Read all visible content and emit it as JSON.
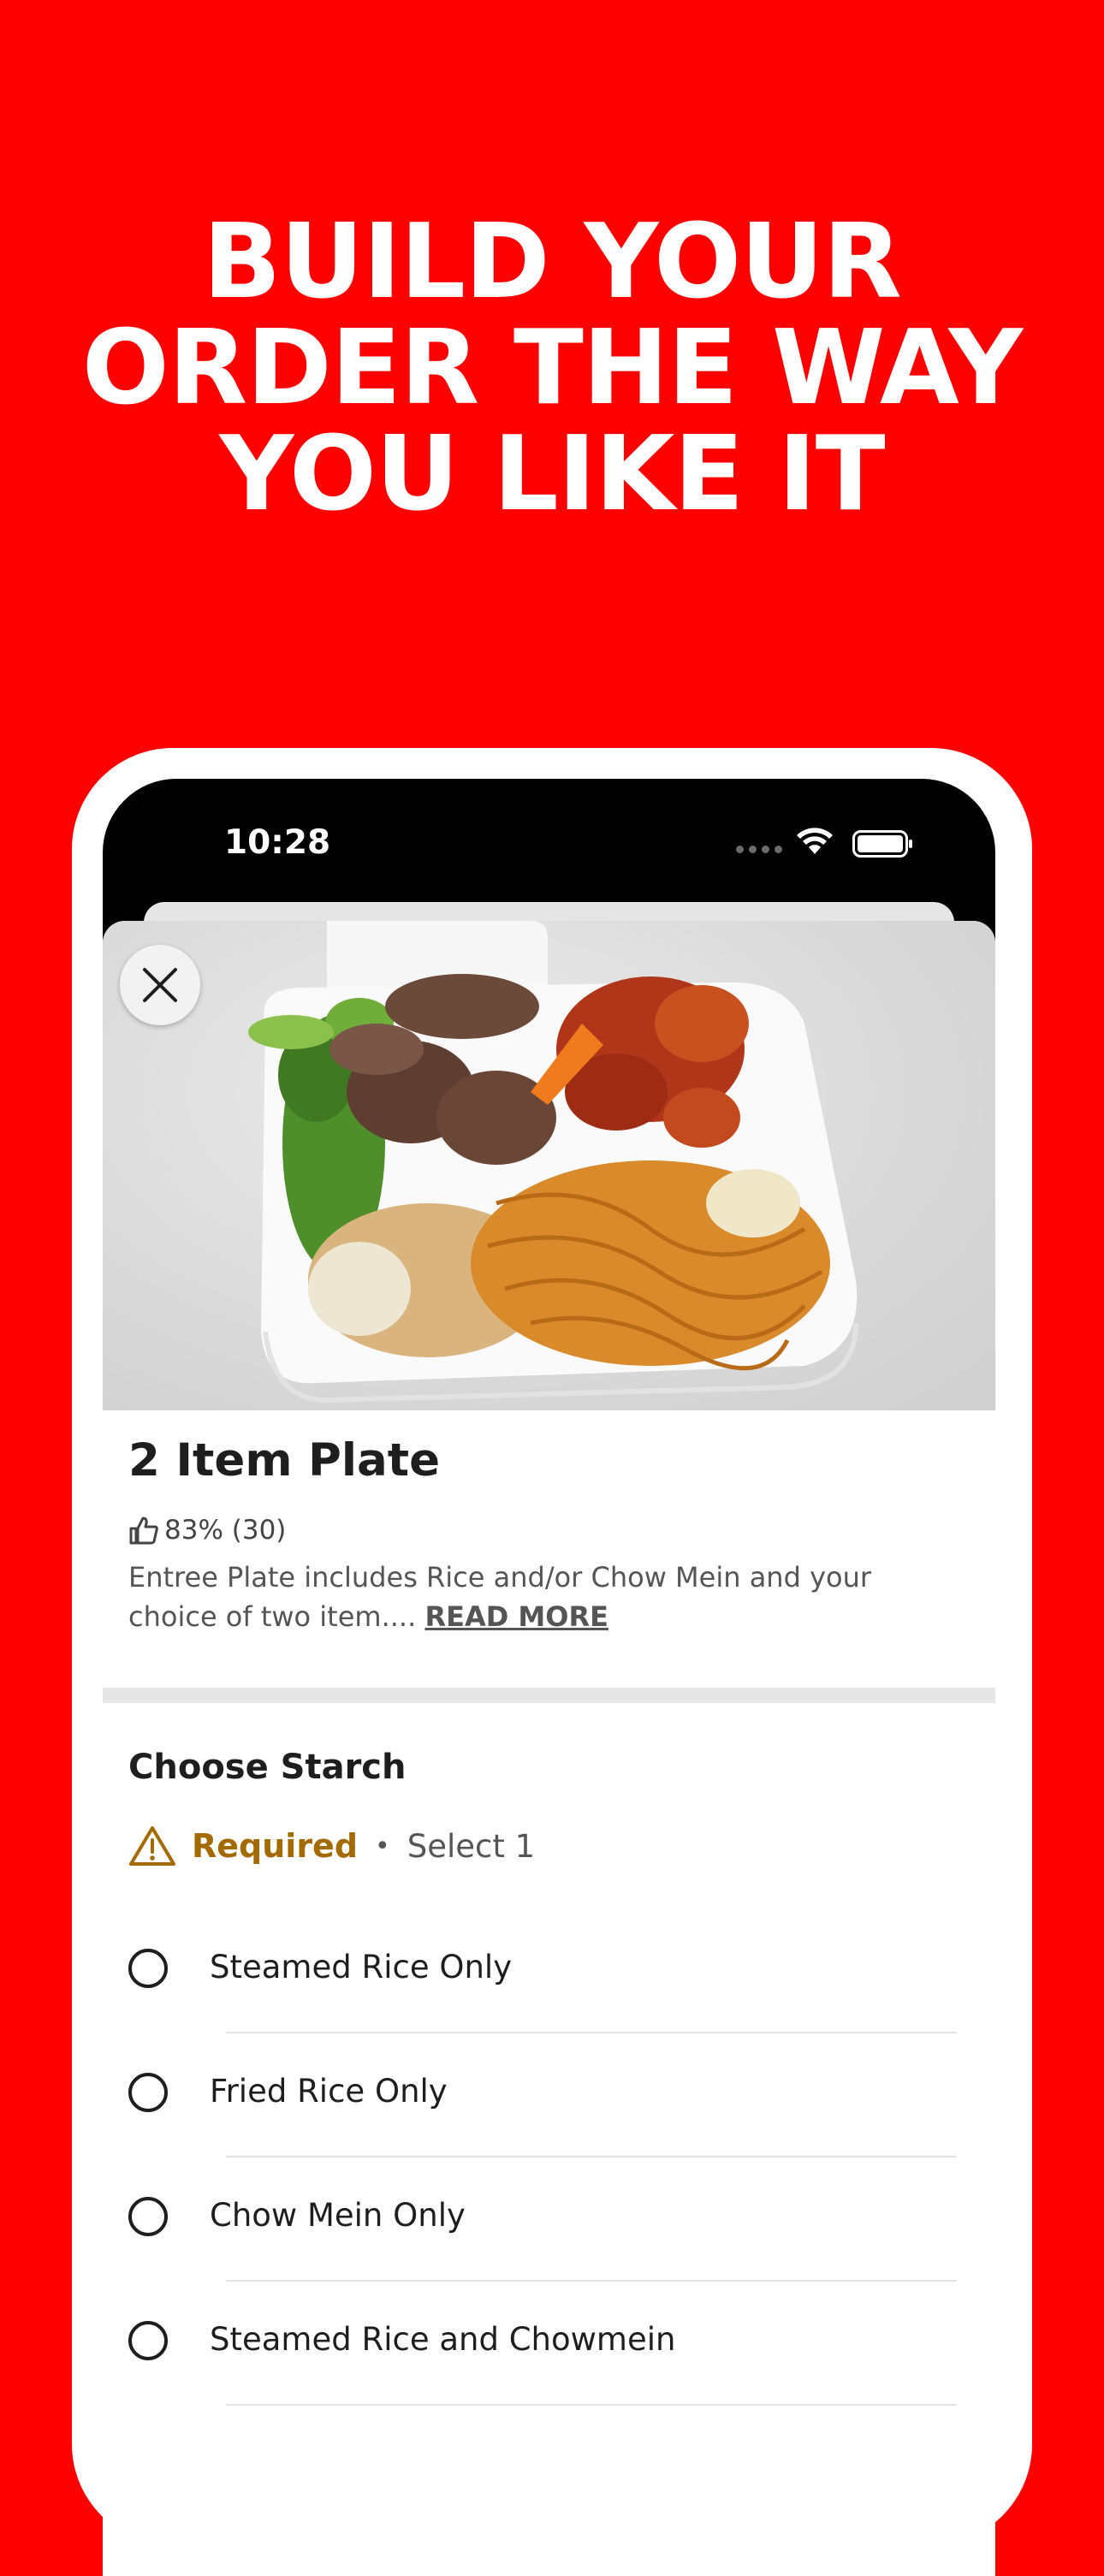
{
  "headline": {
    "line1": "BUILD YOUR",
    "line2": "ORDER THE WAY",
    "line3": "YOU LIKE IT"
  },
  "status_bar": {
    "time": "10:28"
  },
  "item": {
    "title": "2 Item Plate",
    "rating": "83% (30)",
    "description": "Entree Plate includes Rice and/or Chow Mein and your choice of two item....",
    "read_more": "READ MORE"
  },
  "section": {
    "title": "Choose Starch",
    "required_label": "Required",
    "separator": "•",
    "select_label": "Select 1",
    "options": [
      {
        "label": "Steamed Rice Only",
        "selected": false
      },
      {
        "label": "Fried Rice Only",
        "selected": false
      },
      {
        "label": "Chow Mein Only",
        "selected": false
      },
      {
        "label": "Steamed Rice and Chowmein",
        "selected": false
      }
    ]
  },
  "icons": {
    "close": "close-icon",
    "thumbs_up": "thumbs-up-icon",
    "warning": "warning-icon",
    "wifi": "wifi-icon",
    "battery": "battery-icon"
  },
  "colors": {
    "background": "#FF0000",
    "required": "#A36A00",
    "text_dark": "#1E1E1E",
    "text_muted": "#555555"
  }
}
